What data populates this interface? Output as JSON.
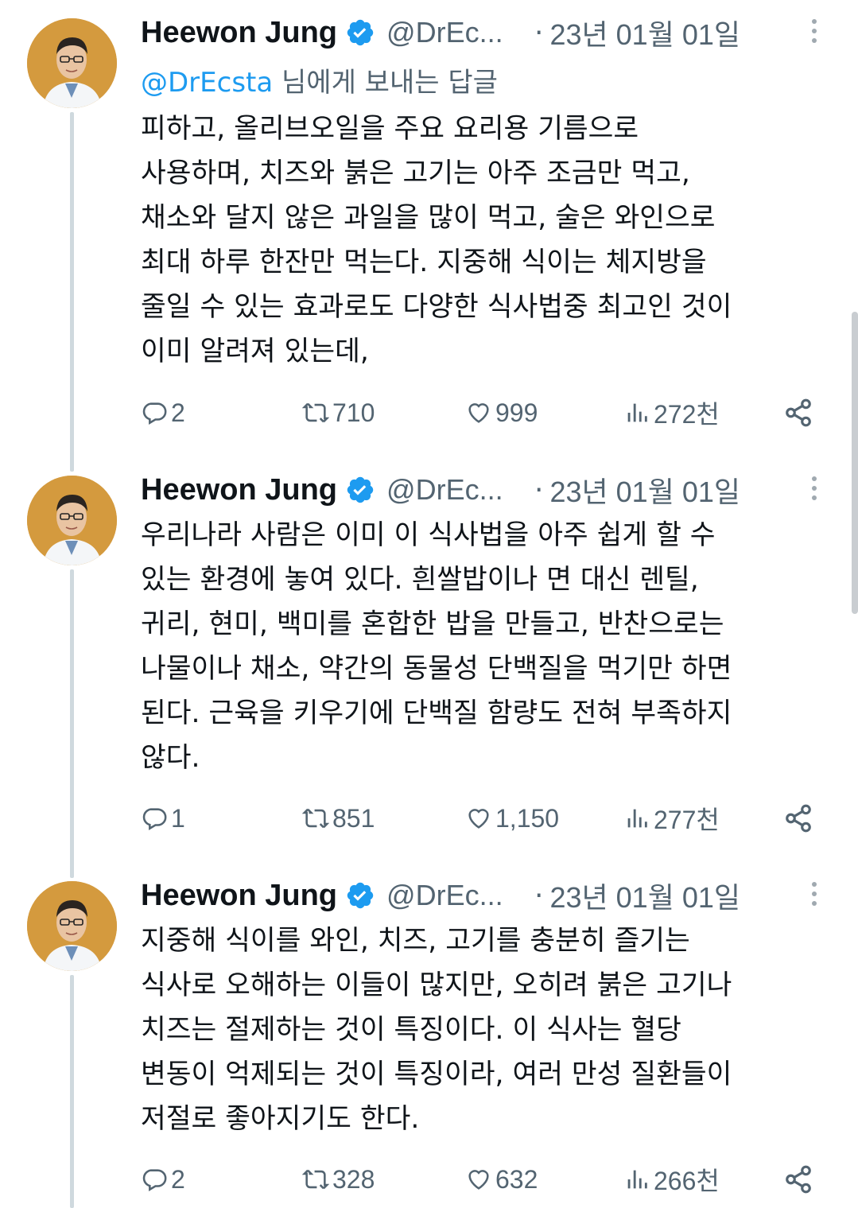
{
  "theme": {
    "link_color": "#1d9bf0",
    "secondary_text": "#536471",
    "verified_color": "#1d9bf0"
  },
  "tweets": [
    {
      "author": "Heewon Jung",
      "handle": "@DrEc...",
      "separator": "·",
      "date": "23년 01월 01일",
      "reply_to_mention": "@DrEcsta",
      "reply_to_suffix": " 님에게 보내는 답글",
      "lines": [
        "피하고, 올리브오일을 주요 요리용 기름으로",
        "사용하며, 치즈와 붉은 고기는 아주 조금만 먹고,",
        "채소와 달지 않은 과일을 많이 먹고, 술은 와인으로",
        "최대 하루 한잔만 먹는다. 지중해 식이는 체지방을",
        "줄일 수 있는 효과로도 다양한 식사법중 최고인 것이",
        "이미 알려져 있는데,"
      ],
      "replies": "2",
      "retweets": "710",
      "likes": "999",
      "views": "272천"
    },
    {
      "author": "Heewon Jung",
      "handle": "@DrEc...",
      "separator": "·",
      "date": "23년 01월 01일",
      "lines": [
        "우리나라 사람은 이미 이 식사법을 아주 쉽게 할 수",
        "있는 환경에 놓여 있다. 흰쌀밥이나 면 대신 렌틸,",
        "귀리, 현미, 백미를 혼합한 밥을 만들고, 반찬으로는",
        "나물이나 채소, 약간의 동물성 단백질을 먹기만 하면",
        "된다. 근육을 키우기에 단백질 함량도 전혀 부족하지",
        "않다."
      ],
      "replies": "1",
      "retweets": "851",
      "likes": "1,150",
      "views": "277천"
    },
    {
      "author": "Heewon Jung",
      "handle": "@DrEc...",
      "separator": "·",
      "date": "23년 01월 01일",
      "lines": [
        "지중해 식이를 와인, 치즈, 고기를 충분히 즐기는",
        "식사로 오해하는 이들이 많지만, 오히려 붉은 고기나",
        "치즈는 절제하는 것이 특징이다. 이 식사는 혈당",
        "변동이 억제되는 것이 특징이라, 여러 만성 질환들이",
        "저절로 좋아지기도 한다."
      ],
      "replies": "2",
      "retweets": "328",
      "likes": "632",
      "views": "266천"
    }
  ]
}
